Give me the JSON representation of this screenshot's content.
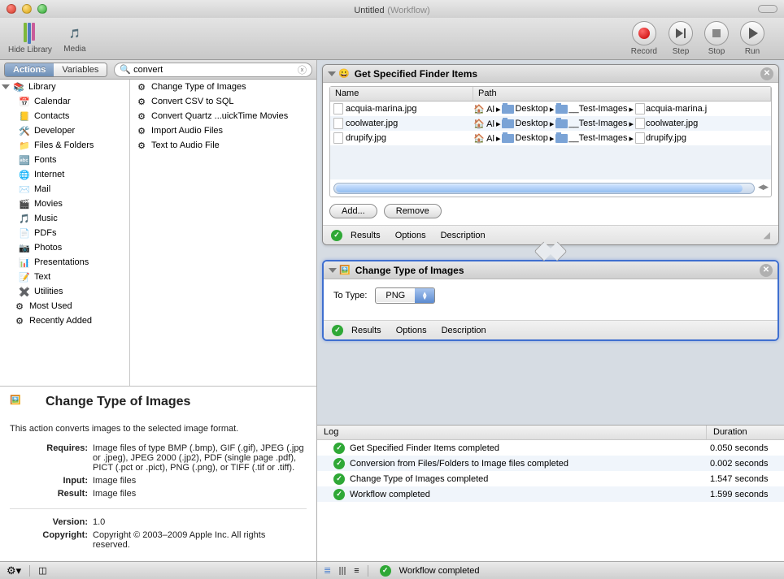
{
  "title": {
    "main": "Untitled",
    "suffix": "(Workflow)"
  },
  "toolbar": {
    "hideLibrary": "Hide Library",
    "media": "Media",
    "record": "Record",
    "step": "Step",
    "stop": "Stop",
    "run": "Run"
  },
  "leftTabs": {
    "actions": "Actions",
    "variables": "Variables"
  },
  "searchValue": "convert",
  "library": {
    "header": "Library",
    "items": [
      "Calendar",
      "Contacts",
      "Developer",
      "Files & Folders",
      "Fonts",
      "Internet",
      "Mail",
      "Movies",
      "Music",
      "PDFs",
      "Photos",
      "Presentations",
      "Text",
      "Utilities"
    ],
    "mostUsed": "Most Used",
    "recent": "Recently Added"
  },
  "actionList": [
    "Change Type of Images",
    "Convert CSV to SQL",
    "Convert Quartz ...uickTime Movies",
    "Import Audio Files",
    "Text to Audio File"
  ],
  "info": {
    "title": "Change Type of Images",
    "desc": "This action converts images to the selected image format.",
    "requiresLabel": "Requires:",
    "requires": "Image files of type BMP (.bmp), GIF (.gif), JPEG (.jpg or .jpeg), JPEG 2000 (.jp2), PDF (single page .pdf), PICT (.pct or .pict), PNG (.png), or TIFF (.tif or .tiff).",
    "inputLabel": "Input:",
    "input": "Image files",
    "resultLabel": "Result:",
    "result": "Image files",
    "versionLabel": "Version:",
    "version": "1.0",
    "copyrightLabel": "Copyright:",
    "copyright": "Copyright © 2003–2009 Apple Inc.  All rights reserved."
  },
  "action1": {
    "title": "Get Specified Finder Items",
    "colName": "Name",
    "colPath": "Path",
    "rows": [
      {
        "name": "acquia-marina.jpg",
        "p": [
          "Al",
          "Desktop",
          "__Test-Images",
          "acquia-marina.j"
        ]
      },
      {
        "name": "coolwater.jpg",
        "p": [
          "Al",
          "Desktop",
          "__Test-Images",
          "coolwater.jpg"
        ]
      },
      {
        "name": "drupify.jpg",
        "p": [
          "Al",
          "Desktop",
          "__Test-Images",
          "drupify.jpg"
        ]
      }
    ],
    "add": "Add...",
    "remove": "Remove",
    "results": "Results",
    "options": "Options",
    "description": "Description"
  },
  "action2": {
    "title": "Change Type of Images",
    "toTypeLabel": "To Type:",
    "toType": "PNG",
    "results": "Results",
    "options": "Options",
    "description": "Description"
  },
  "log": {
    "hLog": "Log",
    "hDur": "Duration",
    "rows": [
      {
        "msg": "Get Specified Finder Items completed",
        "dur": "0.050 seconds"
      },
      {
        "msg": "Conversion from Files/Folders to Image files completed",
        "dur": "0.002 seconds"
      },
      {
        "msg": "Change Type of Images completed",
        "dur": "1.547 seconds"
      },
      {
        "msg": "Workflow completed",
        "dur": "1.599 seconds"
      }
    ]
  },
  "status": "Workflow completed"
}
